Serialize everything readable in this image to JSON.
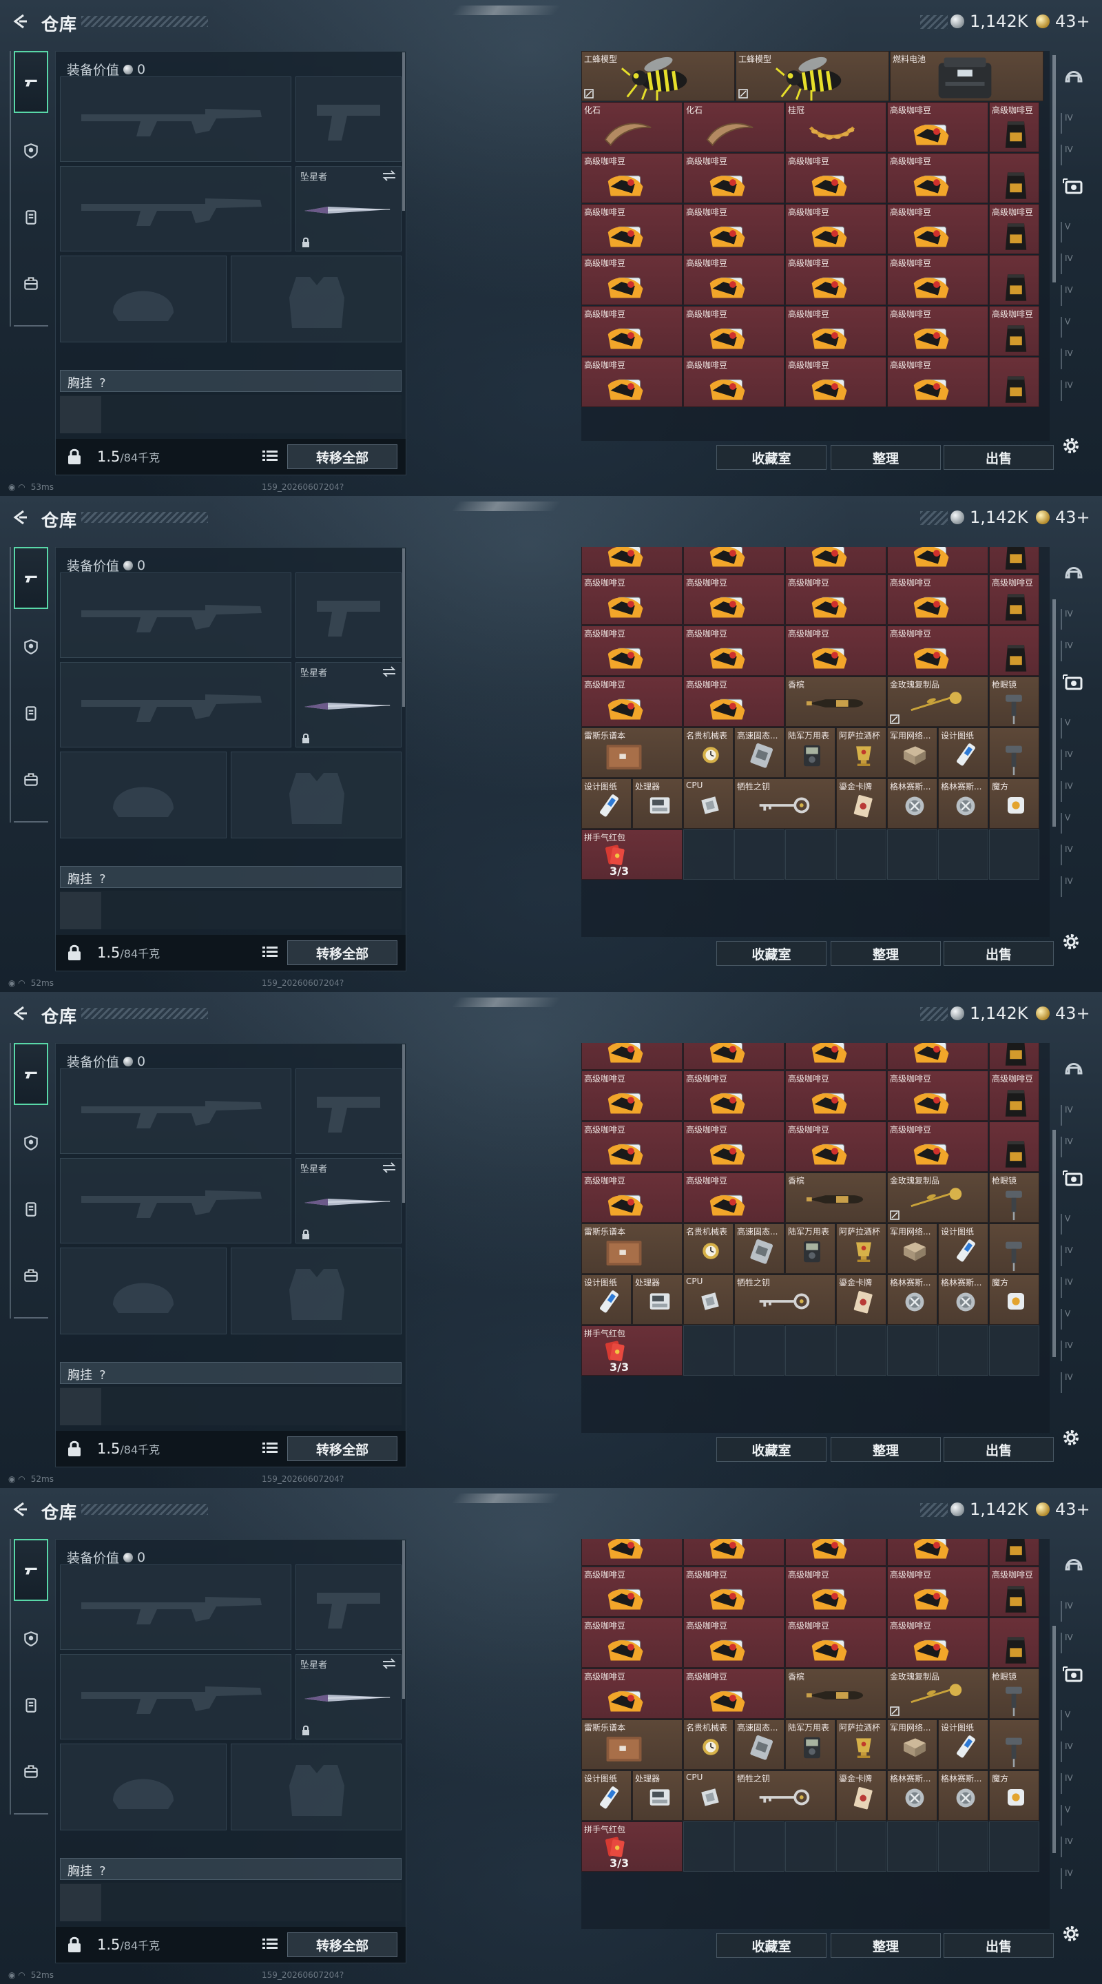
{
  "header": {
    "title": "仓库",
    "currency_silver": "1,142K",
    "currency_gold": "43+"
  },
  "sidebar": {
    "tabs": [
      "weapon-tab",
      "armor-tab",
      "chest-rig-tab",
      "backpack-tab"
    ]
  },
  "equipment": {
    "value_label": "装备价值",
    "value": "0",
    "melee_name": "坠星者",
    "chest_rig_label": "胸挂",
    "chest_rig_hint": "?",
    "weight_value": "1.5",
    "weight_capacity": "/84千克",
    "transfer_all": "转移全部"
  },
  "footer_buttons": {
    "collection": "收藏室",
    "sort": "整理",
    "sell": "出售"
  },
  "status": {
    "ping_panel_1": "53ms",
    "ping_panel_2": "52ms",
    "ping_panel_3": "52ms",
    "ping_panel_4": "52ms",
    "build": "159_20260607204?"
  },
  "panel1_rows": [
    [
      {
        "n": "工蜂模型",
        "i": "bee",
        "c": "brown",
        "w": 1,
        "tag": true
      },
      {
        "n": "工蜂模型",
        "i": "bee",
        "c": "brown",
        "w": 1,
        "tag": true
      },
      {
        "n": "燃料电池",
        "i": "battery",
        "c": "brown",
        "w": 1
      }
    ],
    [
      {
        "n": "化石",
        "i": "fossil",
        "c": "maroon"
      },
      {
        "n": "化石",
        "i": "fossil",
        "c": "maroon"
      },
      {
        "n": "桂冠",
        "i": "laurel",
        "c": "maroon"
      },
      {
        "n": "高级咖啡豆",
        "i": "coffee",
        "c": "maroon"
      },
      {
        "n": "高级咖啡豆",
        "i": "bag",
        "c": "maroon"
      }
    ],
    [
      {
        "n": "高级咖啡豆",
        "i": "coffee",
        "c": "maroon"
      },
      {
        "n": "高级咖啡豆",
        "i": "coffee",
        "c": "maroon"
      },
      {
        "n": "高级咖啡豆",
        "i": "coffee",
        "c": "maroon"
      },
      {
        "n": "高级咖啡豆",
        "i": "coffee",
        "c": "maroon"
      },
      {
        "n": "",
        "i": "bag",
        "c": "maroon"
      }
    ],
    [
      {
        "n": "高级咖啡豆",
        "i": "coffee",
        "c": "maroon"
      },
      {
        "n": "高级咖啡豆",
        "i": "coffee",
        "c": "maroon"
      },
      {
        "n": "高级咖啡豆",
        "i": "coffee",
        "c": "maroon"
      },
      {
        "n": "高级咖啡豆",
        "i": "coffee",
        "c": "maroon"
      },
      {
        "n": "高级咖啡豆",
        "i": "bag",
        "c": "maroon"
      }
    ],
    [
      {
        "n": "高级咖啡豆",
        "i": "coffee",
        "c": "maroon"
      },
      {
        "n": "高级咖啡豆",
        "i": "coffee",
        "c": "maroon"
      },
      {
        "n": "高级咖啡豆",
        "i": "coffee",
        "c": "maroon"
      },
      {
        "n": "高级咖啡豆",
        "i": "coffee",
        "c": "maroon"
      },
      {
        "n": "",
        "i": "bag",
        "c": "maroon"
      }
    ],
    [
      {
        "n": "高级咖啡豆",
        "i": "coffee",
        "c": "maroon"
      },
      {
        "n": "高级咖啡豆",
        "i": "coffee",
        "c": "maroon"
      },
      {
        "n": "高级咖啡豆",
        "i": "coffee",
        "c": "maroon"
      },
      {
        "n": "高级咖啡豆",
        "i": "coffee",
        "c": "maroon"
      },
      {
        "n": "高级咖啡豆",
        "i": "bag",
        "c": "maroon"
      }
    ],
    [
      {
        "n": "高级咖啡豆",
        "i": "coffee",
        "c": "maroon"
      },
      {
        "n": "高级咖啡豆",
        "i": "coffee",
        "c": "maroon"
      },
      {
        "n": "高级咖啡豆",
        "i": "coffee",
        "c": "maroon"
      },
      {
        "n": "高级咖啡豆",
        "i": "coffee",
        "c": "maroon"
      },
      {
        "n": "",
        "i": "bag",
        "c": "maroon"
      }
    ]
  ],
  "lower_rows": [
    [
      {
        "n": "高级咖啡豆",
        "i": "coffee",
        "c": "maroon"
      },
      {
        "n": "高级咖啡豆",
        "i": "coffee",
        "c": "maroon"
      },
      {
        "n": "高级咖啡豆",
        "i": "coffee",
        "c": "maroon"
      },
      {
        "n": "高级咖啡豆",
        "i": "coffee",
        "c": "maroon"
      },
      {
        "n": "",
        "i": "bag",
        "c": "maroon"
      }
    ],
    [
      {
        "n": "高级咖啡豆",
        "i": "coffee",
        "c": "maroon"
      },
      {
        "n": "高级咖啡豆",
        "i": "coffee",
        "c": "maroon"
      },
      {
        "n": "高级咖啡豆",
        "i": "coffee",
        "c": "maroon"
      },
      {
        "n": "高级咖啡豆",
        "i": "coffee",
        "c": "maroon"
      },
      {
        "n": "高级咖啡豆",
        "i": "bag",
        "c": "maroon"
      }
    ],
    [
      {
        "n": "高级咖啡豆",
        "i": "coffee",
        "c": "maroon"
      },
      {
        "n": "高级咖啡豆",
        "i": "coffee",
        "c": "maroon"
      },
      {
        "n": "高级咖啡豆",
        "i": "coffee",
        "c": "maroon"
      },
      {
        "n": "高级咖啡豆",
        "i": "coffee",
        "c": "maroon"
      },
      {
        "n": "",
        "i": "bag",
        "c": "maroon"
      }
    ],
    [
      {
        "n": "高级咖啡豆",
        "i": "coffee",
        "c": "maroon"
      },
      {
        "n": "高级咖啡豆",
        "i": "coffee",
        "c": "maroon"
      },
      {
        "n": "香槟",
        "i": "bottle",
        "c": "brown",
        "w": 1
      },
      {
        "n": "金玫瑰复制品",
        "i": "rose",
        "c": "brown",
        "w": 1,
        "tag": true
      },
      {
        "n": "枪眼镜",
        "i": "drill",
        "c": "brown"
      }
    ],
    [
      {
        "n": "雷斯乐谱本",
        "i": "book",
        "c": "brown",
        "w": 1
      },
      {
        "n": "名贵机械表",
        "i": "watch",
        "c": "brown"
      },
      {
        "n": "高速固态...",
        "i": "ssd",
        "c": "brown"
      },
      {
        "n": "陆军万用表",
        "i": "meter",
        "c": "brown"
      },
      {
        "n": "阿萨拉酒杯",
        "i": "cup",
        "c": "brown"
      },
      {
        "n": "军用网络...",
        "i": "box",
        "c": "brown"
      },
      {
        "n": "设计图纸",
        "i": "usb",
        "c": "brown"
      },
      {
        "n": "",
        "i": "drill",
        "c": "brown"
      }
    ],
    [
      {
        "n": "设计图纸",
        "i": "usb",
        "c": "brown"
      },
      {
        "n": "处理器",
        "i": "device",
        "c": "brown"
      },
      {
        "n": "CPU",
        "i": "cpu",
        "c": "brown"
      },
      {
        "n": "牺牲之钥",
        "i": "key",
        "c": "brown",
        "w": 1
      },
      {
        "n": "鎏金卡牌",
        "i": "card",
        "c": "brown"
      },
      {
        "n": "格林赛斯...",
        "i": "reactor",
        "c": "brown"
      },
      {
        "n": "格林赛斯...",
        "i": "reactor",
        "c": "brown"
      },
      {
        "n": "魔方",
        "i": "cube",
        "c": "brown"
      }
    ],
    [
      {
        "n": "拼手气红包",
        "i": "redpacket",
        "c": "maroon",
        "count": "3/3"
      }
    ]
  ]
}
